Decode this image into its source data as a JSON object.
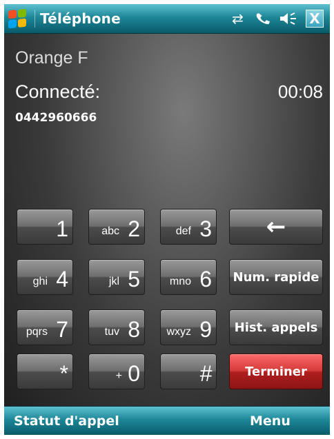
{
  "header": {
    "app_title": "Téléphone",
    "close_label": "X",
    "icons": {
      "connectivity": "sync-arrows-icon",
      "phone": "phone-handset-icon",
      "volume": "speaker-icon"
    }
  },
  "call": {
    "operator": "Orange F",
    "status": "Connecté:",
    "timer": "00:08",
    "number": "0442960666"
  },
  "keypad": {
    "keys": [
      {
        "digit": "1",
        "letters": ""
      },
      {
        "digit": "2",
        "letters": "abc"
      },
      {
        "digit": "3",
        "letters": "def"
      },
      {
        "digit": "4",
        "letters": "ghi"
      },
      {
        "digit": "5",
        "letters": "jkl"
      },
      {
        "digit": "6",
        "letters": "mno"
      },
      {
        "digit": "7",
        "letters": "pqrs"
      },
      {
        "digit": "8",
        "letters": "tuv"
      },
      {
        "digit": "9",
        "letters": "wxyz"
      },
      {
        "digit": "*",
        "letters": ""
      },
      {
        "digit": "0",
        "letters": "+"
      },
      {
        "digit": "#",
        "letters": ""
      }
    ],
    "backspace": "←",
    "speed_dial": "Num. rapide",
    "call_history": "Hist. appels",
    "end_call": "Terminer"
  },
  "softkeys": {
    "left": "Statut d'appel",
    "right": "Menu"
  },
  "colors": {
    "bar": "#1d8798",
    "end_call": "#d43a3a",
    "logo_red": "#f25022",
    "logo_green": "#7fba00",
    "logo_blue": "#00a4ef",
    "logo_yellow": "#ffb900"
  }
}
